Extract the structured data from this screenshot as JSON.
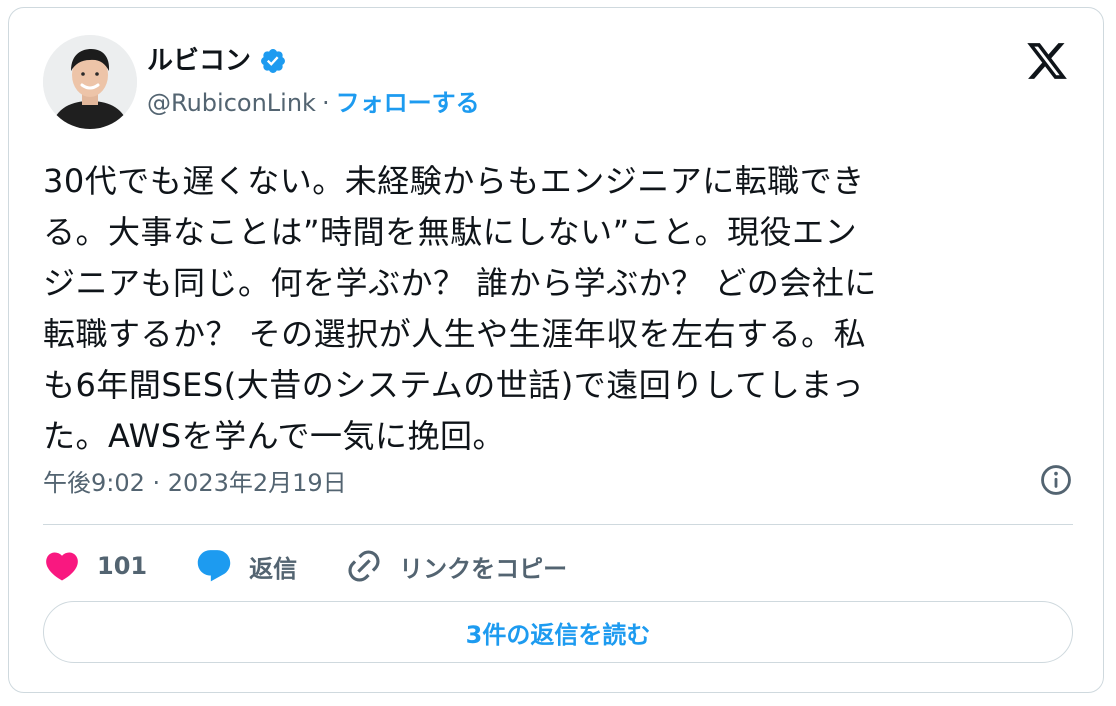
{
  "author": {
    "display_name": "ルビコン",
    "handle": "@RubiconLink",
    "separator": "·",
    "follow_label": "フォローする",
    "verified_icon": "verified-badge-icon",
    "avatar": "profile-photo"
  },
  "brand": {
    "logo_icon": "x-logo-icon"
  },
  "tweet": {
    "text": "30代でも遅くない。未経験からもエンジニアに転職でき\nる。大事なことは”時間を無駄にしない”こと。現役エン\nジニアも同じ。何を学ぶか？ 誰から学ぶか？ どの会社に\n転職するか？ その選択が人生や生涯年収を左右する。私\nも6年間SES(大昔のシステムの世話)で遠回りしてしまっ\nた。AWSを学んで一気に挽回。",
    "timestamp": "午後9:02 · 2023年2月19日"
  },
  "actions": {
    "like_count": "101",
    "reply_label": "返信",
    "copy_link_label": "リンクをコピー"
  },
  "footer": {
    "read_replies_label": "3件の返信を読む"
  },
  "colors": {
    "accent": "#1d9bf0",
    "like": "#f91880",
    "text": "#0f1419",
    "muted": "#536471",
    "border": "#cfd9de"
  }
}
